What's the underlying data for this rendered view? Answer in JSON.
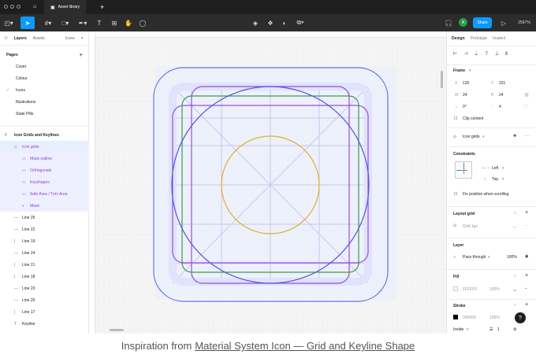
{
  "app": {
    "file_tab": "Asset library",
    "share_label": "Share",
    "avatar_letter": "A",
    "zoom": "2567%"
  },
  "left_panel": {
    "tabs": {
      "layers": "Layers",
      "assets": "Assets",
      "icons": "Icons"
    },
    "pages_title": "Pages",
    "pages": [
      "Cover",
      "Colour",
      "Icons",
      "Illustrations",
      "State Pills"
    ],
    "layer_group": "Icon Grids and Keylines",
    "layers": [
      "Icon grids",
      "Mask outline",
      "Orthogonals",
      "Keyshapes",
      "Safe Area / Trim Area",
      "Mask",
      "Line 25",
      "Line 22",
      "Line 19",
      "Line 24",
      "Line 21",
      "Line 18",
      "Line 23",
      "Line 20",
      "Line 17",
      "Keyline"
    ]
  },
  "right_panel": {
    "tabs": {
      "design": "Design",
      "prototype": "Prototype",
      "inspect": "Inspect"
    },
    "frame": {
      "title": "Frame",
      "x": "125",
      "y": "231",
      "w": "24",
      "h": "24",
      "rotation": "0°",
      "radius": "4",
      "clip": "Clip content"
    },
    "component": "Icon grids",
    "constraints": {
      "title": "Constraints",
      "horizontal": "Left",
      "vertical": "Top",
      "fix": "Fix position when scrolling"
    },
    "layout_grid": {
      "title": "Layout grid",
      "value": "Grid 1px"
    },
    "layer": {
      "title": "Layer",
      "blend": "Pass through",
      "opacity": "100%"
    },
    "fill": {
      "title": "Fill",
      "hex": "FFFFFF",
      "opacity": "100%"
    },
    "stroke": {
      "title": "Stroke",
      "hex": "000000",
      "opacity": "100%",
      "position": "Inside",
      "weight": "1"
    }
  },
  "caption": {
    "prefix": "Inspiration from",
    "link": "Material System Icon — Grid and Keyline Shape"
  },
  "colors": {
    "accent": "#0d99ff",
    "keyline_blue": "#6b6cf0",
    "keyline_purple": "#9b4ce0",
    "keyline_green": "#3f9a4e",
    "keyline_yellow": "#e0ae2a"
  }
}
